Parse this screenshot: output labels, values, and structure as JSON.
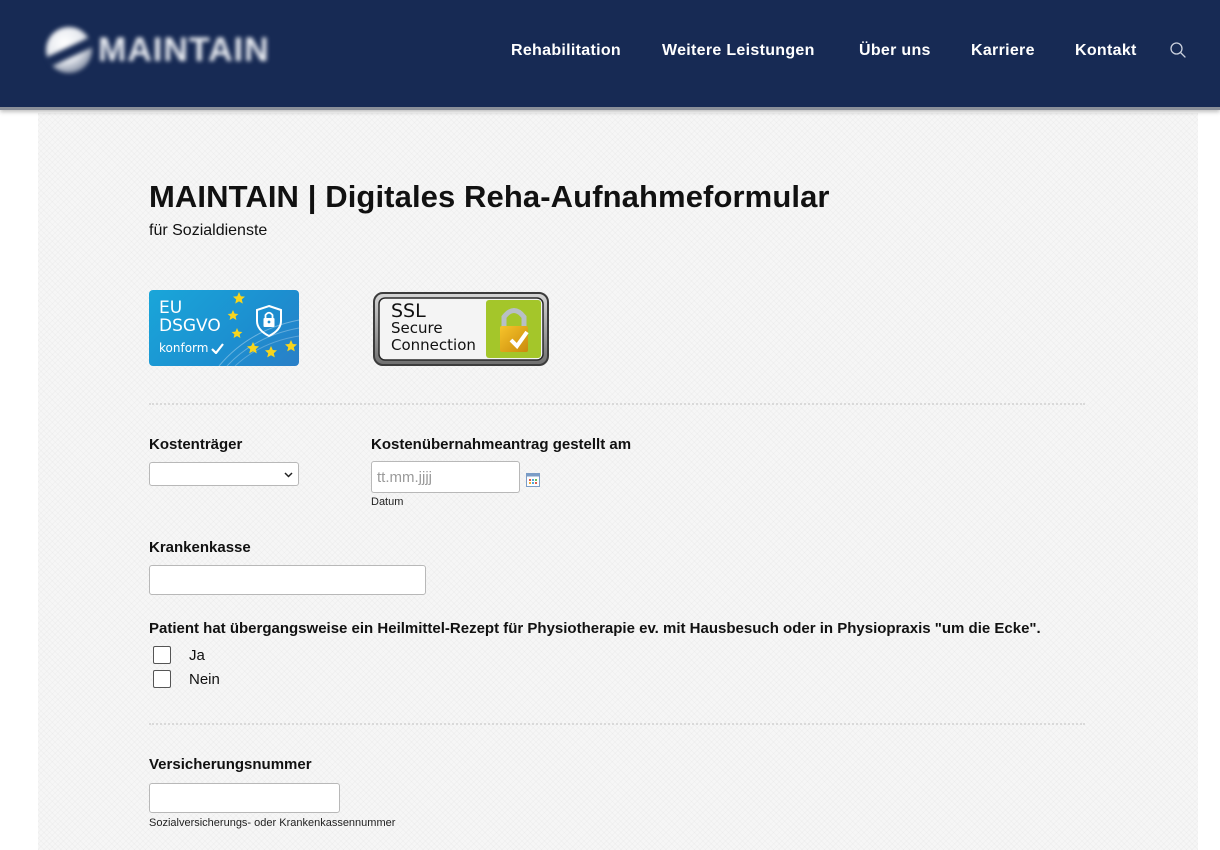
{
  "header": {
    "logo_text": "MAINTAIN",
    "nav": [
      {
        "label": "Rehabilitation"
      },
      {
        "label": "Weitere Leistungen"
      },
      {
        "label": "Über uns"
      },
      {
        "label": "Karriere"
      },
      {
        "label": "Kontakt"
      }
    ],
    "search_icon": "search-icon"
  },
  "colors": {
    "header_bg": "#172a54",
    "eu_badge_bg": "#1c8fd0",
    "ssl_lock": "#9cc41c"
  },
  "page": {
    "title": "MAINTAIN | Digitales Reha-Aufnahmeformular",
    "subtitle": "für Sozialdienste"
  },
  "badges": {
    "eu": {
      "line1": "EU",
      "line2": "DSGVO",
      "line3": "konform"
    },
    "ssl": {
      "line1": "SSL",
      "line2": "Secure",
      "line3": "Connection"
    }
  },
  "form": {
    "kostentraeger": {
      "label": "Kostenträger",
      "value": ""
    },
    "antrag": {
      "label": "Kostenübernahmeantrag gestellt am",
      "placeholder": "tt.mm.jjjj",
      "sublabel": "Datum"
    },
    "krankenkasse": {
      "label": "Krankenkasse",
      "value": ""
    },
    "rezept": {
      "question": "Patient hat übergangsweise ein Heilmittel-Rezept für Physiotherapie ev. mit Hausbesuch oder in Physiopraxis \"um die Ecke\".",
      "options": [
        {
          "label": "Ja",
          "checked": false
        },
        {
          "label": "Nein",
          "checked": false
        }
      ]
    },
    "versicherungsnummer": {
      "label": "Versicherungsnummer",
      "value": "",
      "sublabel": "Sozialversicherungs- oder Krankenkassennummer"
    }
  }
}
